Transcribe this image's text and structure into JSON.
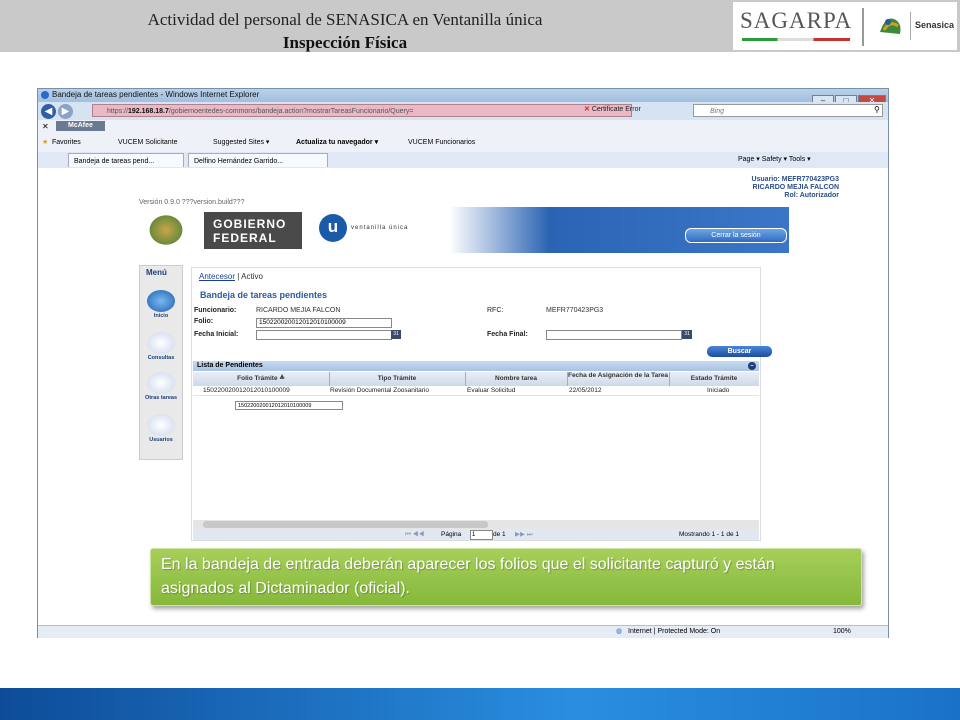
{
  "slide": {
    "title": "Actividad del personal de SENASICA en Ventanilla  única",
    "subtitle": "Inspección Física",
    "logo_sagarpa": "SAGARPA",
    "logo_senasica": "Senasica"
  },
  "browser": {
    "window_title": "Bandeja de tareas pendientes - Windows Internet Explorer",
    "window_buttons": [
      "–",
      "□",
      "✕"
    ],
    "address_prefix": "https://",
    "address_host": "192.168.18.7",
    "address_path": "/gobiernoentedes-commons/bandeja.action?mostrarTareasFuncionario/Query=",
    "cert_error": "Certificate Error",
    "search_placeholder": "Bing",
    "toolbar_mcafee": "McAfee",
    "favorites": "Favorites",
    "fav_items": [
      "VUCEM Solicitante",
      "Suggested Sites ▾",
      "Actualiza tu navegador ▾",
      "VUCEM Funcionarios"
    ],
    "tabs": [
      "Bandeja de tareas pend...",
      "Delfino Hernández Garrido..."
    ],
    "command_bar": "Page ▾   Safety ▾   Tools ▾",
    "status_zone": "Internet | Protected Mode: On",
    "zoom": "100%"
  },
  "app": {
    "version": "Versión 0.9.0 ???version.build???",
    "user_line1": "Usuario: MEFR770423PG3",
    "user_line2": "RICARDO MEJIA FALCON",
    "user_line3": "Rol: Autorizador",
    "gobierno_line1": "GOBIERNO",
    "gobierno_line2": "FEDERAL",
    "u_letter": "u",
    "ventanilla": "ventanilla única",
    "logout": "Cerrar la sesión",
    "menu_title": "Menú",
    "menu_items": [
      "Inicio",
      "Consultas",
      "Otras tareas",
      "Usuarios"
    ],
    "crumb_link": "Antecesor",
    "crumb_rest": " | Activo",
    "panel_title": "Bandeja de tareas pendientes",
    "funcionario_label": "Funcionario:",
    "funcionario_value": "RICARDO   MEJIA   FALCON",
    "rfc_label": "RFC:",
    "rfc_value": "MEFR770423PG3",
    "folio_label": "Folio:",
    "folio_value": "150220020012012010100009",
    "fecha_inicial_label": "Fecha Inicial:",
    "fecha_final_label": "Fecha Final:",
    "buscar": "Buscar",
    "lista_title": "Lista de Pendientes",
    "columns": [
      "Folio Trámite ≜",
      "Tipo Trámite",
      "Nombre tarea",
      "Fecha de Asignación de la Tarea",
      "Estado Trámite"
    ],
    "row": [
      "150220020012012010100009",
      "Revisión Documental Zoosanitario",
      "Evaluar Solicitud",
      "22/05/2012",
      "Iniciado"
    ],
    "tooltip": "150220020012012010100009",
    "pager_label": "Página",
    "pager_value": "1",
    "pager_of": "de 1",
    "pager_summary": "Mostrando 1 - 1 de 1"
  },
  "callout": "En la bandeja de entrada deberán aparecer los folios que el solicitante capturó y están asignados al Dictaminador (oficial).",
  "colors": {
    "header_gray": "#c9c9c9",
    "banner_blue": "#2c64b4",
    "callout_green": "#95c44a",
    "footer_blue": "#1a72c8"
  }
}
